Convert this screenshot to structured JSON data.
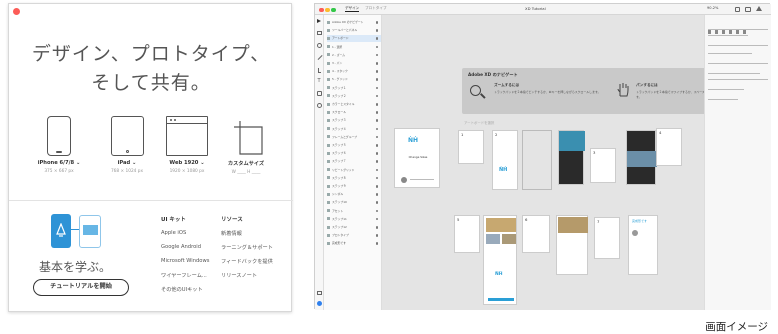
{
  "welcome": {
    "headline_line1": "デザイン、プロトタイプ、",
    "headline_line2": "そして共有。",
    "presets": [
      {
        "label": "iPhone 6/7/8 ⌄",
        "size": "375 × 667 px"
      },
      {
        "label": "iPad ⌄",
        "size": "768 × 1024 px"
      },
      {
        "label": "Web 1920 ⌄",
        "size": "1920 × 1080 px"
      },
      {
        "label": "カスタムサイズ",
        "size": "W ____  H ____"
      }
    ],
    "learn_title": "基本を学ぶ。",
    "tutorial_button": "チュートリアルを開始",
    "ui_kit": {
      "heading": "UI キット",
      "items": [
        "Apple iOS",
        "Google Android",
        "Microsoft Windows",
        "ワイヤーフレーム...",
        "その他のUIキット"
      ]
    },
    "resources": {
      "heading": "リソース",
      "items": [
        "新着情報",
        "ラーニング＆サポート",
        "フィードバックを提供",
        "リリースノート"
      ]
    }
  },
  "xd": {
    "tabs": [
      "デザイン",
      "プロトタイプ"
    ],
    "file_title": "XD Tutorial",
    "zoom": "90.2%",
    "navigate_title": "Adobe XD のナビゲート",
    "zoom_hint_title": "ズームするには",
    "zoom_hint_body": "トラックパッドを２本指でピンチするか、⌘キーを押しながらスクロールします。",
    "pan_hint_title": "パンするには",
    "pan_hint_body": "トラックパッドを２本指でスワイプするか、スペースバーを押しながらドラッグします。",
    "artboard_hint": "アートボードを選択",
    "artboard_title": "Change Sizes",
    "artboard_numbers": [
      "1",
      "2",
      "3",
      "4",
      "5",
      "6",
      "7",
      "8"
    ],
    "layer_names": [
      "Adobe XD のナビゲート",
      "ツールバーとパネル",
      "アートボード",
      "1 - 選択",
      "2 - ズーム",
      "3 - パン",
      "4 - スタック",
      "5 - グリッド",
      "ステップ１",
      "ステップ２",
      "カラーとスタイル",
      "スクロール",
      "ステップ３",
      "ステップ４",
      "フレームとグループ",
      "ステップ５",
      "ステップ６",
      "ステップ７",
      "リピートグリッド",
      "ステップ８",
      "ステップ９",
      "シンボル",
      "ステップ10",
      "アセット",
      "ステップ11",
      "ステップ12",
      "プロトタイプ",
      "完成形です"
    ]
  },
  "caption": "画面イメージ"
}
